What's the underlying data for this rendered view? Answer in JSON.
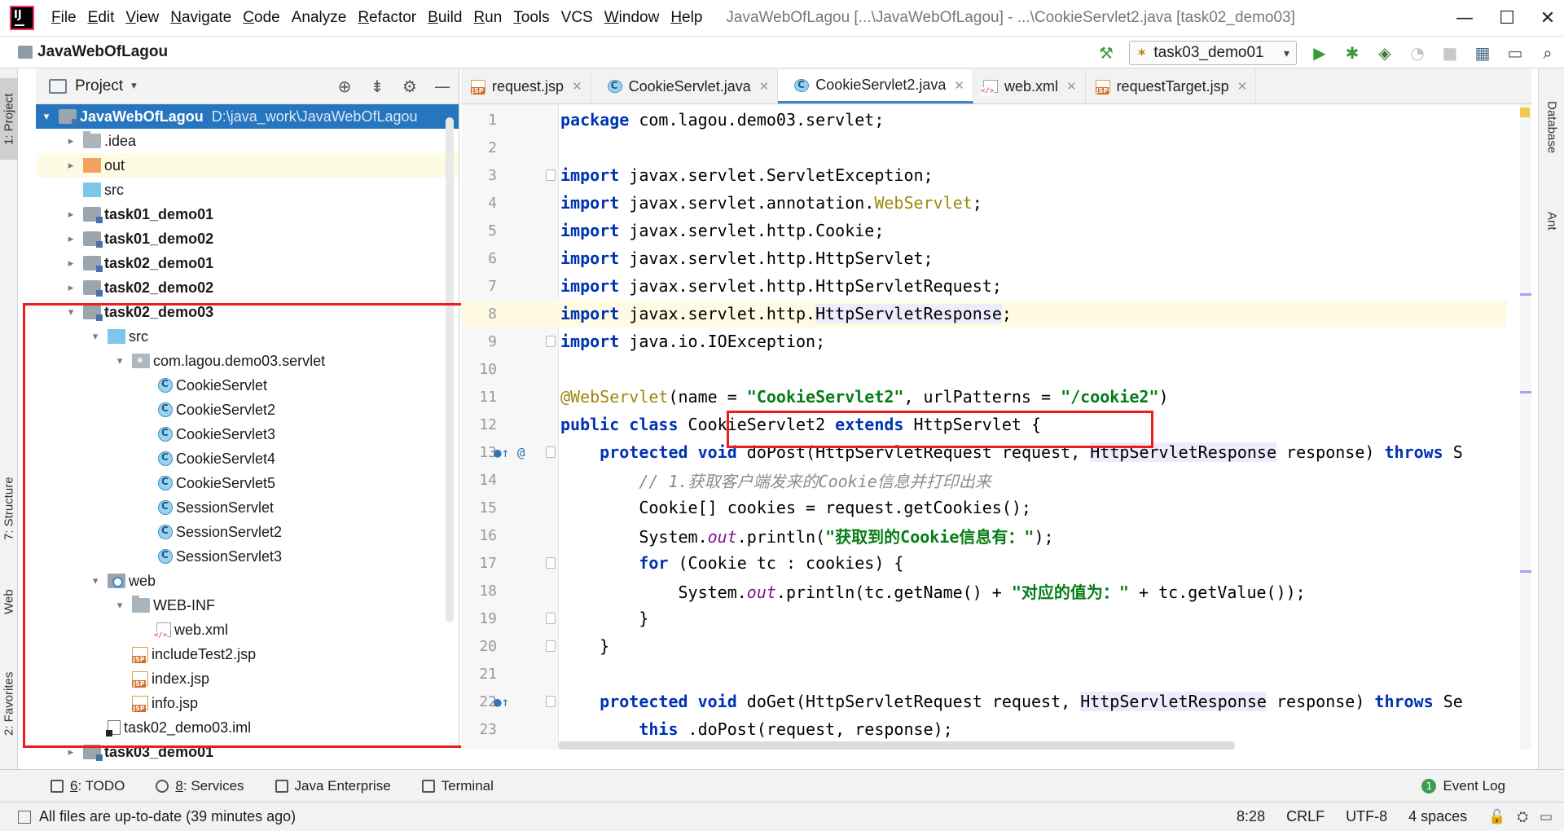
{
  "menubar": {
    "items": [
      {
        "ul": "F",
        "rest": "ile"
      },
      {
        "ul": "E",
        "rest": "dit"
      },
      {
        "ul": "V",
        "rest": "iew"
      },
      {
        "ul": "N",
        "rest": "avigate"
      },
      {
        "ul": "C",
        "rest": "ode"
      },
      {
        "ul": "",
        "rest": "Analyze"
      },
      {
        "ul": "R",
        "rest": "efactor"
      },
      {
        "ul": "B",
        "rest": "uild"
      },
      {
        "ul": "R",
        "rest": "un"
      },
      {
        "ul": "T",
        "rest": "ools"
      },
      {
        "ul": "",
        "rest": "VCS"
      },
      {
        "ul": "W",
        "rest": "indow"
      },
      {
        "ul": "H",
        "rest": "elp"
      }
    ],
    "window_title": "JavaWebOfLagou [...\\JavaWebOfLagou] - ...\\CookieServlet2.java [task02_demo03]",
    "minimize_glyph": "—",
    "maximize_glyph": "☐",
    "close_glyph": "✕"
  },
  "navbar": {
    "project_name": "JavaWebOfLagou",
    "run_config": "task03_demo01",
    "icons": [
      "hammer-icon",
      "run-icon",
      "debug-icon",
      "coverage-icon",
      "profile-icon",
      "stop-icon",
      "project-structure-icon",
      "presentation-icon",
      "search-icon"
    ]
  },
  "left_stripe": {
    "project": "1: Project",
    "structure": "7: Structure",
    "web": "Web",
    "favorites": "2: Favorites"
  },
  "right_stripe": {
    "database": "Database",
    "ant": "Ant"
  },
  "project_panel": {
    "title": "Project",
    "tree": [
      {
        "depth": 0,
        "arrow": "▾",
        "icon": "module",
        "label": "JavaWebOfLagou",
        "hint": "D:\\java_work\\JavaWebOfLagou",
        "bold": true,
        "selected": true
      },
      {
        "depth": 1,
        "arrow": "▸",
        "icon": "folder",
        "label": ".idea"
      },
      {
        "depth": 1,
        "arrow": "▸",
        "icon": "folder-orange",
        "label": "out",
        "highlight": true
      },
      {
        "depth": 1,
        "arrow": "",
        "icon": "folder-src",
        "label": "src"
      },
      {
        "depth": 1,
        "arrow": "▸",
        "icon": "module",
        "label": "task01_demo01",
        "bold": true
      },
      {
        "depth": 1,
        "arrow": "▸",
        "icon": "module",
        "label": "task01_demo02",
        "bold": true
      },
      {
        "depth": 1,
        "arrow": "▸",
        "icon": "module",
        "label": "task02_demo01",
        "bold": true
      },
      {
        "depth": 1,
        "arrow": "▸",
        "icon": "module",
        "label": "task02_demo02",
        "bold": true
      },
      {
        "depth": 1,
        "arrow": "▾",
        "icon": "module",
        "label": "task02_demo03",
        "bold": true
      },
      {
        "depth": 2,
        "arrow": "▾",
        "icon": "folder-src",
        "label": "src"
      },
      {
        "depth": 3,
        "arrow": "▾",
        "icon": "package",
        "label": "com.lagou.demo03.servlet"
      },
      {
        "depth": 4,
        "arrow": "",
        "icon": "java-class",
        "label": "CookieServlet"
      },
      {
        "depth": 4,
        "arrow": "",
        "icon": "java-class",
        "label": "CookieServlet2"
      },
      {
        "depth": 4,
        "arrow": "",
        "icon": "java-class",
        "label": "CookieServlet3"
      },
      {
        "depth": 4,
        "arrow": "",
        "icon": "java-class",
        "label": "CookieServlet4"
      },
      {
        "depth": 4,
        "arrow": "",
        "icon": "java-class",
        "label": "CookieServlet5"
      },
      {
        "depth": 4,
        "arrow": "",
        "icon": "java-class",
        "label": "SessionServlet"
      },
      {
        "depth": 4,
        "arrow": "",
        "icon": "java-class",
        "label": "SessionServlet2"
      },
      {
        "depth": 4,
        "arrow": "",
        "icon": "java-class",
        "label": "SessionServlet3"
      },
      {
        "depth": 2,
        "arrow": "▾",
        "icon": "web-folder",
        "label": "web"
      },
      {
        "depth": 3,
        "arrow": "▾",
        "icon": "folder",
        "label": "WEB-INF"
      },
      {
        "depth": 4,
        "arrow": "",
        "icon": "xml",
        "label": "web.xml"
      },
      {
        "depth": 3,
        "arrow": "",
        "icon": "jsp",
        "label": "includeTest2.jsp"
      },
      {
        "depth": 3,
        "arrow": "",
        "icon": "jsp",
        "label": "index.jsp"
      },
      {
        "depth": 3,
        "arrow": "",
        "icon": "jsp",
        "label": "info.jsp"
      },
      {
        "depth": 2,
        "arrow": "",
        "icon": "iml",
        "label": "task02_demo03.iml"
      },
      {
        "depth": 1,
        "arrow": "▸",
        "icon": "module",
        "label": "task03_demo01",
        "bold": true
      }
    ]
  },
  "editor": {
    "tabs": [
      {
        "label": "request.jsp",
        "icon": "jsp",
        "active": false
      },
      {
        "label": "CookieServlet.java",
        "icon": "java-class",
        "active": false
      },
      {
        "label": "CookieServlet2.java",
        "icon": "java-class",
        "active": true
      },
      {
        "label": "web.xml",
        "icon": "xml",
        "active": false
      },
      {
        "label": "requestTarget.jsp",
        "icon": "jsp",
        "active": false
      }
    ],
    "current_line": 8,
    "lines": [
      {
        "n": "1",
        "parts": [
          [
            "kw",
            "package"
          ],
          [
            "",
            "com.lagou.demo03.servlet;"
          ]
        ]
      },
      {
        "n": "2",
        "parts": []
      },
      {
        "n": "3",
        "fold": true,
        "parts": [
          [
            "kw",
            "import"
          ],
          [
            "",
            "javax.servlet.ServletException;"
          ]
        ]
      },
      {
        "n": "4",
        "parts": [
          [
            "kw",
            "import"
          ],
          [
            "",
            "javax.servlet.annotation."
          ],
          [
            "annref",
            "WebServlet"
          ],
          [
            "",
            ";"
          ]
        ]
      },
      {
        "n": "5",
        "parts": [
          [
            "kw",
            "import"
          ],
          [
            "",
            "javax.servlet.http.Cookie;"
          ]
        ]
      },
      {
        "n": "6",
        "parts": [
          [
            "kw",
            "import"
          ],
          [
            "",
            "javax.servlet.http.HttpServlet;"
          ]
        ]
      },
      {
        "n": "7",
        "parts": [
          [
            "kw",
            "import"
          ],
          [
            "",
            "javax.servlet.http.HttpServletRequest;"
          ]
        ]
      },
      {
        "n": "8",
        "parts": [
          [
            "kw",
            "import"
          ],
          [
            "",
            "javax.servlet.http."
          ],
          [
            "hl",
            "HttpServletResponse"
          ],
          [
            "",
            ";"
          ]
        ]
      },
      {
        "n": "9",
        "fold": true,
        "parts": [
          [
            "kw",
            "import"
          ],
          [
            "",
            "java.io.IOException;"
          ]
        ]
      },
      {
        "n": "10",
        "parts": []
      },
      {
        "n": "11",
        "parts": [
          [
            "ann",
            "@WebServlet"
          ],
          [
            "",
            "(name = "
          ],
          [
            "str",
            "\"CookieServlet2\""
          ],
          [
            "",
            ", urlPatterns = "
          ],
          [
            "str",
            "\"/cookie2\""
          ],
          [
            "",
            ")"
          ]
        ]
      },
      {
        "n": "12",
        "parts": [
          [
            "kw",
            "public class"
          ],
          [
            "",
            " CookieServlet2 "
          ],
          [
            "kw",
            "extends"
          ],
          [
            "",
            " HttpServlet {"
          ]
        ]
      },
      {
        "n": "13",
        "marks": "●↑ @",
        "fold": true,
        "parts": [
          [
            "",
            "    "
          ],
          [
            "kw",
            "protected void"
          ],
          [
            "",
            " doPost(HttpServletRequest request, "
          ],
          [
            "hl",
            "HttpServletResponse"
          ],
          [
            "",
            " response) "
          ],
          [
            "kw",
            "throws"
          ],
          [
            "",
            " S"
          ]
        ]
      },
      {
        "n": "14",
        "parts": [
          [
            "",
            "        "
          ],
          [
            "cmt",
            "// 1.获取客户端发来的Cookie信息并打印出来"
          ]
        ]
      },
      {
        "n": "15",
        "parts": [
          [
            "",
            "        Cookie[] cookies = request.getCookies();"
          ]
        ]
      },
      {
        "n": "16",
        "parts": [
          [
            "",
            "        System."
          ],
          [
            "ital",
            "out"
          ],
          [
            "",
            ".println("
          ],
          [
            "str",
            "\"获取到的Cookie信息有：\""
          ],
          [
            "",
            ");"
          ]
        ]
      },
      {
        "n": "17",
        "fold": true,
        "parts": [
          [
            "",
            "        "
          ],
          [
            "kw",
            "for"
          ],
          [
            "",
            " (Cookie tc : cookies) {"
          ]
        ]
      },
      {
        "n": "18",
        "parts": [
          [
            "",
            "            System."
          ],
          [
            "ital",
            "out"
          ],
          [
            "",
            ".println(tc.getName() + "
          ],
          [
            "str",
            "\"对应的值为：\""
          ],
          [
            "",
            " + tc.getValue());"
          ]
        ]
      },
      {
        "n": "19",
        "fold": true,
        "parts": [
          [
            "",
            "        }"
          ]
        ]
      },
      {
        "n": "20",
        "fold": true,
        "parts": [
          [
            "",
            "    }"
          ]
        ]
      },
      {
        "n": "21",
        "parts": []
      },
      {
        "n": "22",
        "marks": "●↑",
        "fold": true,
        "parts": [
          [
            "",
            "    "
          ],
          [
            "kw",
            "protected void"
          ],
          [
            "",
            " doGet(HttpServletRequest request, "
          ],
          [
            "hl",
            "HttpServletResponse"
          ],
          [
            "",
            " response) "
          ],
          [
            "kw",
            "throws"
          ],
          [
            "",
            " Se"
          ]
        ]
      },
      {
        "n": "23",
        "parts": [
          [
            "",
            "        "
          ],
          [
            "kw",
            "this"
          ],
          [
            "",
            ".doPost(request, response);"
          ]
        ]
      }
    ]
  },
  "tool_bar": {
    "todo": {
      "ul": "6",
      "rest": ": TODO"
    },
    "services": {
      "ul": "8",
      "rest": ": Services"
    },
    "java_enterprise": "Java Enterprise",
    "terminal": "Terminal",
    "event_log": "Event Log",
    "event_log_count": "1"
  },
  "status_bar": {
    "message": "All files are up-to-date (39 minutes ago)",
    "position": "8:28",
    "line_sep": "CRLF",
    "encoding": "UTF-8",
    "indent": "4 spaces"
  },
  "colors": {
    "annotation_red": "#ee1c1c",
    "selection_blue": "#2675bf",
    "keyword": "#0033b3",
    "string": "#067d17"
  }
}
